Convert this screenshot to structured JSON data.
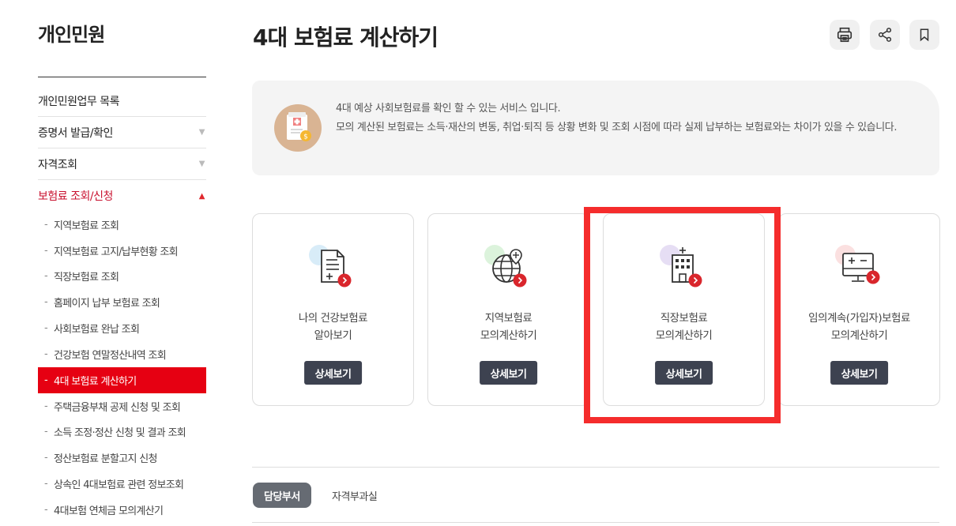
{
  "sidebar": {
    "title": "개인민원",
    "menu": [
      {
        "label": "개인민원업무 목록",
        "arrow": ""
      },
      {
        "label": "증명서 발급/확인",
        "arrow": "▼"
      },
      {
        "label": "자격조회",
        "arrow": "▼"
      },
      {
        "label": "보험료 조회/신청",
        "arrow": "▲"
      }
    ],
    "submenu": [
      "지역보험료 조회",
      "지역보험료 고지/납부현황 조회",
      "직장보험료 조회",
      "홈페이지 납부 보험료 조회",
      "사회보험료 완납 조회",
      "건강보험 연말정산내역 조회",
      "4대 보험료 계산하기",
      "주택금융부채 공제 신청 및 조회",
      "소득 조정·정산 신청 및 결과 조회",
      "정산보험료 분할고지 신청",
      "상속인 4대보험료 관련 정보조회",
      "4대보험 연체금 모의계산기"
    ],
    "dash": "-"
  },
  "header": {
    "title": "4대 보험료 계산하기"
  },
  "info": {
    "line1": "4대 예상 사회보험료를 확인 할 수 있는 서비스 입니다.",
    "line2": "모의 계산된 보험료는 소득·재산의 변동, 취업·퇴직 등 상황 변화 및 조회 시점에 따라 실제 납부하는 보험료와는 차이가 있을 수 있습니다."
  },
  "cards": [
    {
      "line1": "나의 건강보험료",
      "line2": "알아보기",
      "button": "상세보기",
      "icon": "document-plus-icon",
      "accent": "#d8ecf8"
    },
    {
      "line1": "지역보험료",
      "line2": "모의계산하기",
      "button": "상세보기",
      "icon": "globe-icon",
      "accent": "#dcf3dc"
    },
    {
      "line1": "직장보험료",
      "line2": "모의계산하기",
      "button": "상세보기",
      "icon": "building-icon",
      "accent": "#e6def4"
    },
    {
      "line1": "임의계속(가입자)보험료",
      "line2": "모의계산하기",
      "button": "상세보기",
      "icon": "calculator-monitor-icon",
      "accent": "#fbe0e0"
    }
  ],
  "tabs": {
    "active": "담당부서",
    "second": "자격부과실"
  },
  "colors": {
    "brand_red": "#e60012",
    "highlight": "#f52c2c",
    "button_dark": "#3d4250"
  }
}
